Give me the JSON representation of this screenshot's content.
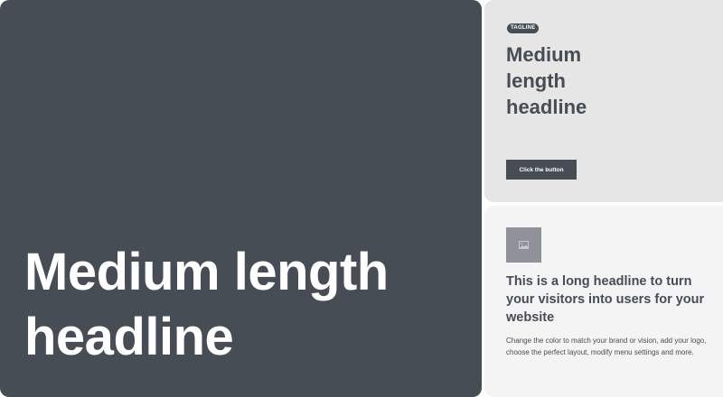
{
  "hero": {
    "headline": "Medium length headline"
  },
  "feature_card": {
    "tagline": "TAGLINE",
    "headline": "Medium length headline",
    "button_label": "Click the button"
  },
  "content_card": {
    "image_icon": "image-placeholder-icon",
    "headline": "This is a long headline to turn your visitors into users for your website",
    "body": "Change the color to match your brand or vision, add your logo, choose the perfect layout, modify menu settings and more."
  },
  "colors": {
    "dark": "#464d55",
    "light_gray": "#e6e6e6",
    "lighter_gray": "#f4f4f4",
    "placeholder": "#8f9399"
  }
}
